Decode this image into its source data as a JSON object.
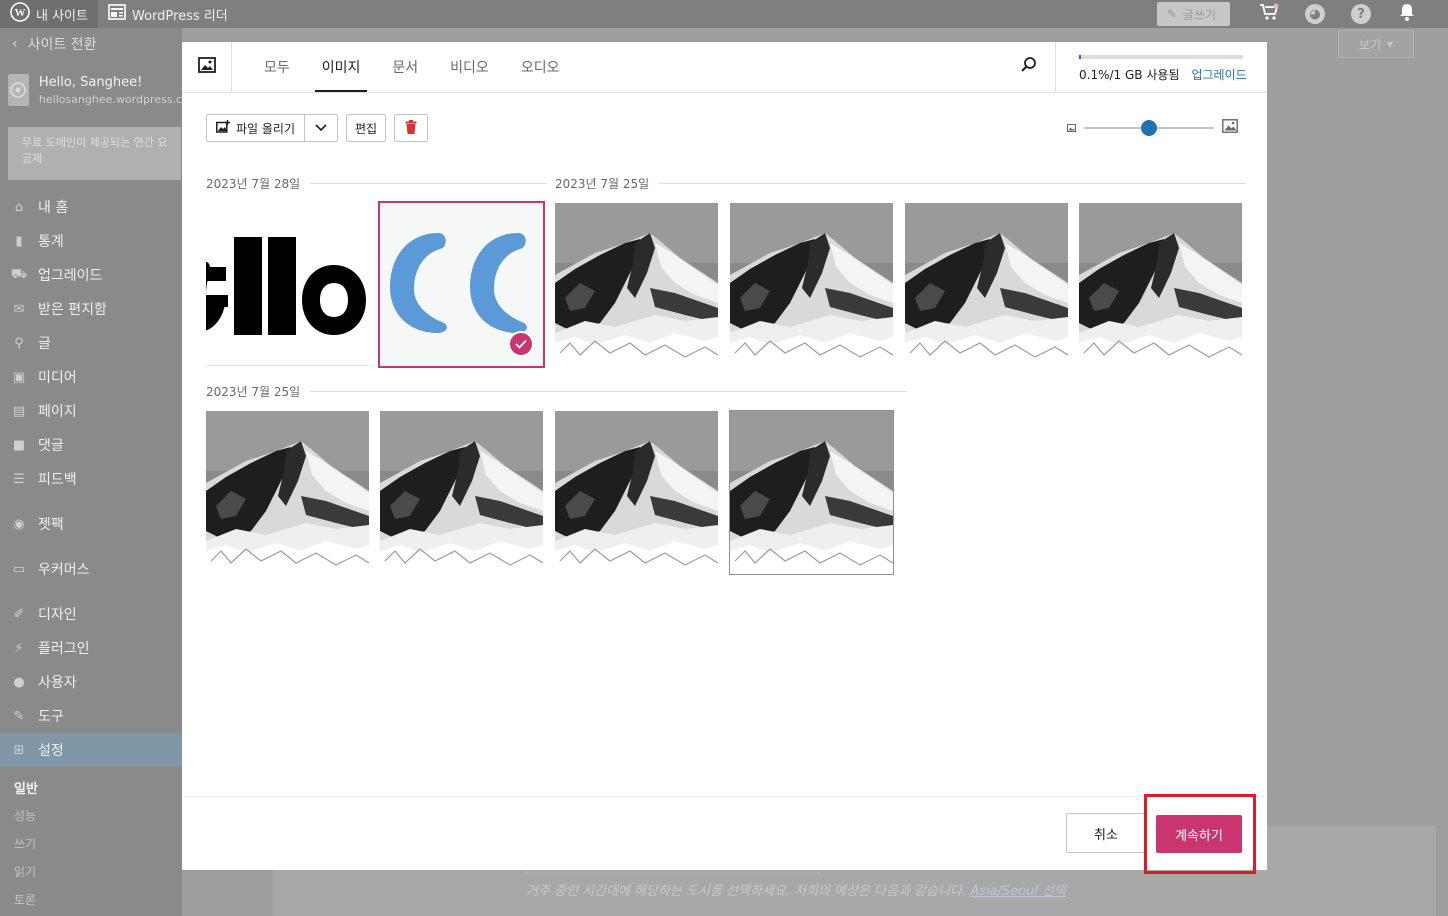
{
  "adminbar": {
    "my_site": "내 사이트",
    "reader": "WordPress 리더",
    "write": "글쓰기"
  },
  "sidebar": {
    "switch_site": "사이트 전환",
    "site_title": "Hello, Sanghee!",
    "site_url": "hellosanghee.wordpress.c",
    "notice": "무료 도메인이 제공되는 연간 요금제",
    "items": [
      {
        "label": "내 홈",
        "icon": "home-icon"
      },
      {
        "label": "통계",
        "icon": "stats-icon"
      },
      {
        "label": "업그레이드",
        "icon": "cart-icon"
      },
      {
        "label": "받은 편지함",
        "icon": "mail-icon"
      },
      {
        "label": "글",
        "icon": "pin-icon"
      },
      {
        "label": "미디어",
        "icon": "media-icon"
      },
      {
        "label": "페이지",
        "icon": "page-icon"
      },
      {
        "label": "댓글",
        "icon": "comment-icon"
      },
      {
        "label": "피드백",
        "icon": "feedback-icon"
      },
      {
        "label": "젯팩",
        "icon": "jetpack-icon"
      },
      {
        "label": "우커머스",
        "icon": "woo-icon"
      },
      {
        "label": "디자인",
        "icon": "brush-icon"
      },
      {
        "label": "플러그인",
        "icon": "plugin-icon"
      },
      {
        "label": "사용자",
        "icon": "user-icon"
      },
      {
        "label": "도구",
        "icon": "wrench-icon"
      },
      {
        "label": "설정",
        "icon": "settings-icon"
      }
    ],
    "subitems": [
      "일반",
      "성능",
      "쓰기",
      "읽기",
      "토론"
    ]
  },
  "background": {
    "view_label": "보기",
    "hint": "거주 중인 시간대에 해당하는 도시를 선택하세요. 저희의 예상은 다음과 같습니다.",
    "hint_link": "Asia/Seoul 선택"
  },
  "modal": {
    "tabs": [
      "모두",
      "이미지",
      "문서",
      "비디오",
      "오디오"
    ],
    "active_tab": "이미지",
    "storage": {
      "text": "0.1%/1 GB 사용됨",
      "upgrade": "업그레이드",
      "percent": 0.1
    },
    "toolbar": {
      "upload": "파일 올리기",
      "edit": "편집"
    },
    "zoom_level": 0.5,
    "groups": [
      {
        "date": "2023년 7월 28일"
      },
      {
        "date": "2023년 7월 25일"
      },
      {
        "date": "2023년 7월 25일"
      }
    ],
    "footer": {
      "cancel": "취소",
      "continue": "계속하기"
    }
  },
  "colors": {
    "accent": "#c9356e",
    "link": "#2271b1",
    "highlight": "#e01b24"
  }
}
